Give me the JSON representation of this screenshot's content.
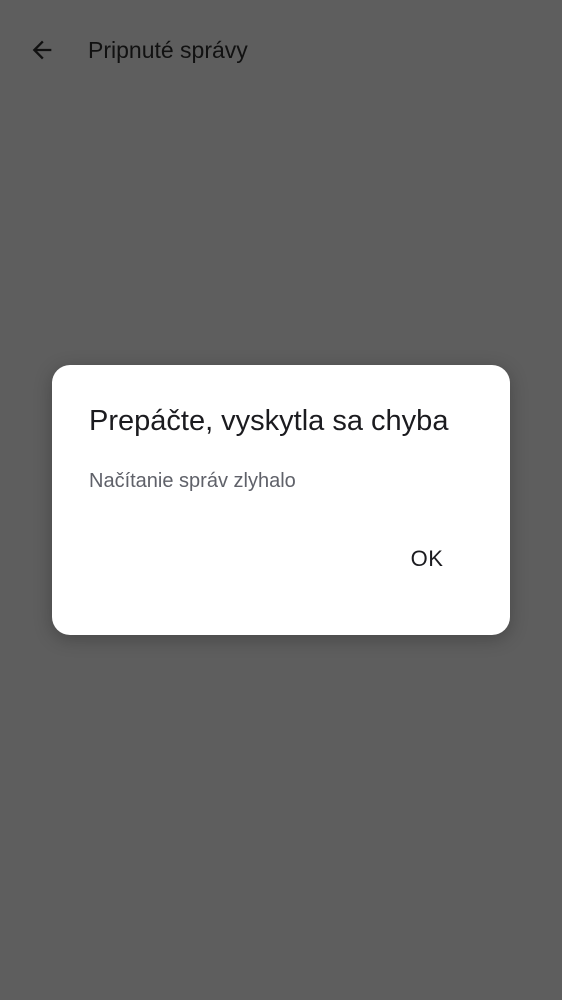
{
  "app_bar": {
    "back_icon": "arrow-left-icon",
    "title": "Pripnuté správy"
  },
  "dialog": {
    "title": "Prepáčte, vyskytla sa chyba",
    "message": "Načítanie správ zlyhalo",
    "ok_label": "OK"
  },
  "colors": {
    "scrim_background": "#5e5e5e",
    "dialog_background": "#ffffff",
    "primary_text": "#1b1b1f",
    "secondary_text": "#5f6169"
  }
}
